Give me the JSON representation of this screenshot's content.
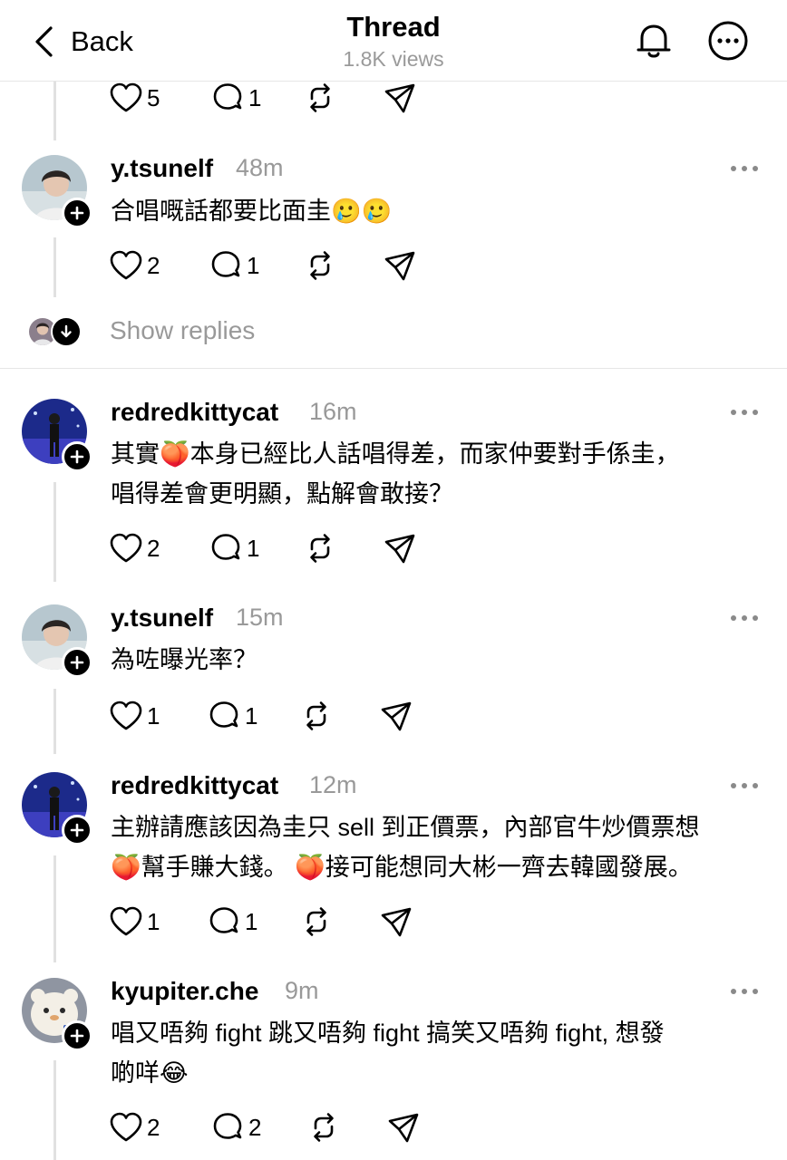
{
  "header": {
    "back_label": "Back",
    "title": "Thread",
    "views": "1.8K views"
  },
  "top_actions": {
    "likes": "5",
    "replies": "1"
  },
  "posts": [
    {
      "username": "y.tsunelf",
      "time": "48m",
      "text": "合唱嘅話都要比面圭",
      "emoji": "🥲🥲",
      "likes": "2",
      "replies": "1"
    },
    {
      "username": "redredkittycat",
      "time": "16m",
      "text_lines": [
        "其實🍑本身已經比人話唱得差，而家仲要對手係圭，",
        "唱得差會更明顯，點解會敢接？"
      ],
      "likes": "2",
      "replies": "1"
    },
    {
      "username": "y.tsunelf",
      "time": "15m",
      "text": "為咗曝光率？",
      "likes": "1",
      "replies": "1"
    },
    {
      "username": "redredkittycat",
      "time": "12m",
      "text_lines": [
        "主辦請應該因為圭只 sell 到正價票，內部官牛炒價票想",
        "🍑幫手賺大錢。 🍑接可能想同大彬一齊去韓國發展。"
      ],
      "likes": "1",
      "replies": "1"
    },
    {
      "username": "kyupiter.che",
      "time": "9m",
      "text_lines": [
        "唱又唔夠 fight 跳又唔夠 fight 搞笑又唔夠 fight, 想發",
        "啲咩😂"
      ],
      "likes": "2",
      "replies": "2"
    }
  ],
  "show_replies": "Show replies",
  "icons": {
    "back": "chevron-left-icon",
    "notifications": "bell-icon",
    "more": "more-circle-icon",
    "like": "heart-icon",
    "reply": "comment-icon",
    "repost": "repost-icon",
    "share": "send-icon"
  },
  "colors": {
    "muted": "#999999",
    "divider": "#e6e6e6",
    "text": "#000000"
  }
}
